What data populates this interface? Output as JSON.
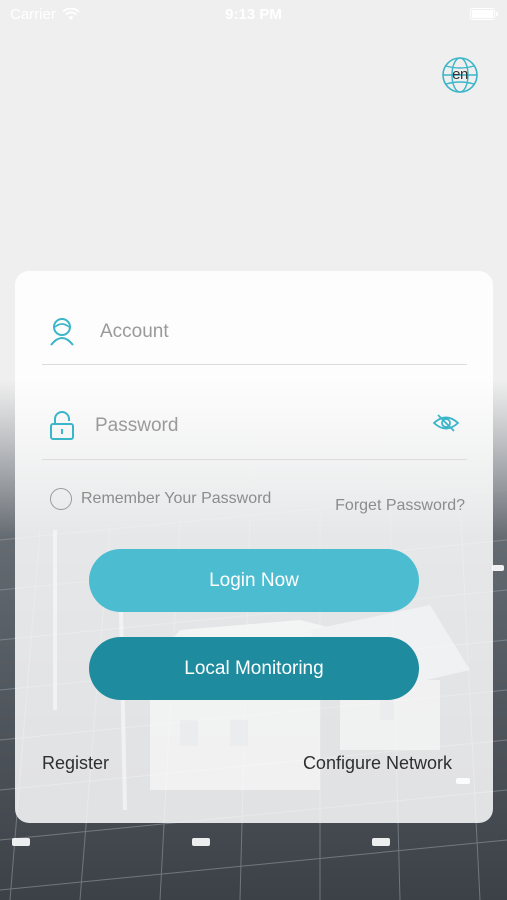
{
  "status_bar": {
    "carrier": "Carrier",
    "time": "9:13 PM"
  },
  "language": {
    "label": "en",
    "icon": "globe-icon"
  },
  "login_form": {
    "account_placeholder": "Account",
    "account_value": "",
    "account_icon": "user-icon",
    "password_placeholder": "Password",
    "password_value": "",
    "password_icon": "lock-icon",
    "visibility_icon": "eye-off-icon",
    "remember_label": "Remember Your Password",
    "remember_checked": false,
    "forget_label": "Forget Password?"
  },
  "buttons": {
    "login": "Login Now",
    "local_monitoring": "Local Monitoring"
  },
  "links": {
    "register": "Register",
    "configure_network": "Configure Network"
  },
  "colors": {
    "accent": "#4cbdd1",
    "accent_dark": "#1e8c9e",
    "icon": "#3bb5c9"
  }
}
